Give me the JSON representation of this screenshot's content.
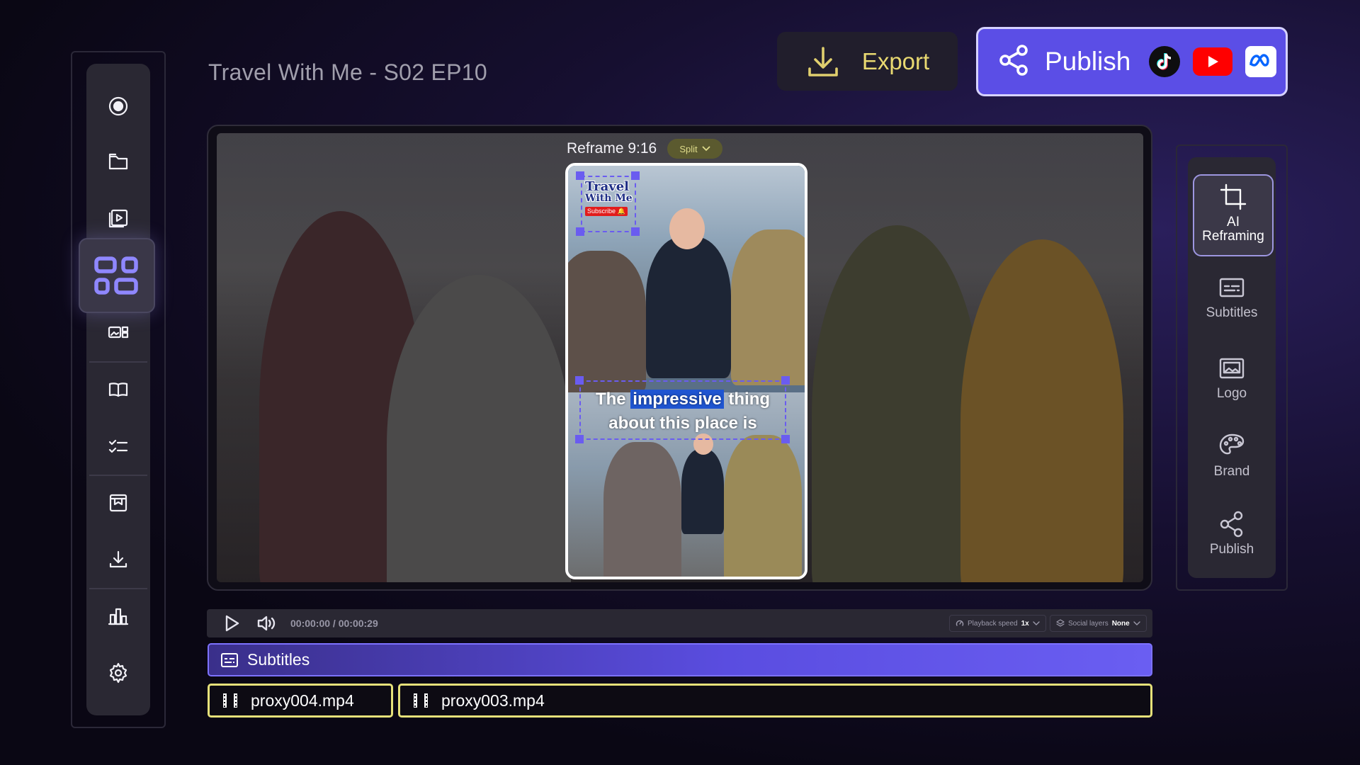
{
  "project": {
    "title": "Travel With Me - S02 EP10"
  },
  "header": {
    "export_label": "Export",
    "publish_label": "Publish",
    "social_icons": [
      "tiktok-icon",
      "youtube-icon",
      "meta-icon"
    ]
  },
  "sidebar": {
    "items": [
      {
        "icon": "record-icon"
      },
      {
        "icon": "folder-icon"
      },
      {
        "icon": "video-library-icon"
      },
      {
        "icon": "layout-icon",
        "active": true
      },
      {
        "icon": "media-layout-icon"
      },
      {
        "icon": "book-icon"
      },
      {
        "icon": "checklist-icon"
      },
      {
        "icon": "archive-icon"
      },
      {
        "icon": "download-icon"
      },
      {
        "icon": "analytics-icon"
      },
      {
        "icon": "gear-icon"
      }
    ]
  },
  "preview": {
    "reframe_label": "Reframe 9:16",
    "split_label": "Split",
    "logo_title_1": "Travel",
    "logo_title_2": "With Me",
    "logo_subscribe": "Subscribe 🔔",
    "caption_pre": "The",
    "caption_highlight": "impressive",
    "caption_post": "thing",
    "caption_line2": "about this place is"
  },
  "right_panel": {
    "tools": [
      {
        "label_1": "AI",
        "label_2": "Reframing",
        "icon": "crop-icon",
        "active": true
      },
      {
        "label": "Subtitles",
        "icon": "subtitles-icon"
      },
      {
        "label": "Logo",
        "icon": "image-icon"
      },
      {
        "label": "Brand",
        "icon": "palette-icon"
      },
      {
        "label": "Publish",
        "icon": "share-icon"
      }
    ]
  },
  "transport": {
    "timecode": "00:00:00 / 00:00:29",
    "playback_speed_label": "Playback speed",
    "playback_speed_value": "1x",
    "social_layers_label": "Social layers",
    "social_layers_value": "None"
  },
  "tracks": {
    "subtitles_label": "Subtitles",
    "clips": [
      "proxy004.mp4",
      "proxy003.mp4"
    ]
  },
  "colors": {
    "accent": "#5b4ee6",
    "export_text": "#e9d971",
    "clip_border": "#e6e17a",
    "handle": "#6a5cf0"
  }
}
